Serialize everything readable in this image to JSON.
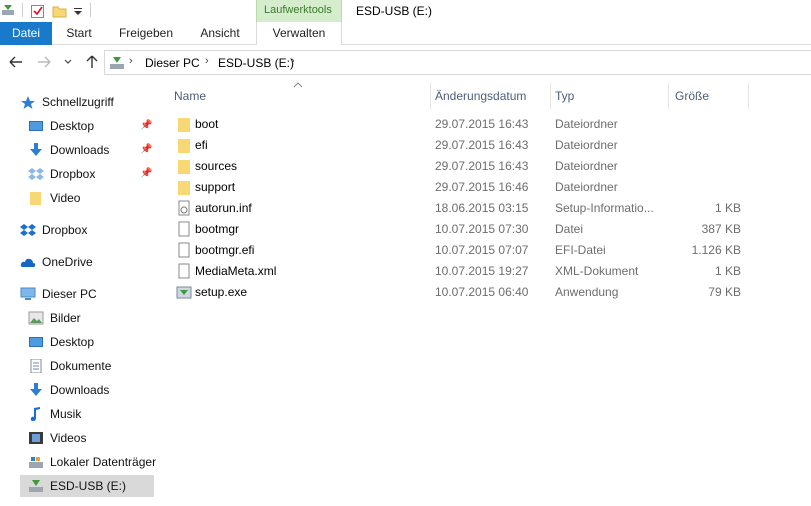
{
  "window": {
    "title": "ESD-USB (E:)",
    "context_tab_group": "Laufwerktools"
  },
  "ribbon": {
    "tabs": [
      "Datei",
      "Start",
      "Freigeben",
      "Ansicht",
      "Verwalten"
    ]
  },
  "address": {
    "crumbs": [
      "Dieser PC",
      "ESD-USB (E:)"
    ]
  },
  "nav": {
    "quick_access": "Schnellzugriff",
    "quick_items": [
      "Desktop",
      "Downloads",
      "Dropbox",
      "Video"
    ],
    "dropbox": "Dropbox",
    "onedrive": "OneDrive",
    "this_pc": "Dieser PC",
    "pc_items": [
      "Bilder",
      "Desktop",
      "Dokumente",
      "Downloads",
      "Musik",
      "Videos",
      "Lokaler Datenträger",
      "ESD-USB (E:)"
    ]
  },
  "columns": {
    "name": "Name",
    "date": "Änderungsdatum",
    "type": "Typ",
    "size": "Größe"
  },
  "files": [
    {
      "name": "boot",
      "date": "29.07.2015 16:43",
      "type": "Dateiordner",
      "size": "",
      "icon": "folder-icon"
    },
    {
      "name": "efi",
      "date": "29.07.2015 16:43",
      "type": "Dateiordner",
      "size": "",
      "icon": "folder-icon"
    },
    {
      "name": "sources",
      "date": "29.07.2015 16:43",
      "type": "Dateiordner",
      "size": "",
      "icon": "folder-icon"
    },
    {
      "name": "support",
      "date": "29.07.2015 16:46",
      "type": "Dateiordner",
      "size": "",
      "icon": "folder-icon"
    },
    {
      "name": "autorun.inf",
      "date": "18.06.2015 03:15",
      "type": "Setup-Informatio...",
      "size": "1 KB",
      "icon": "setup-info-file-icon"
    },
    {
      "name": "bootmgr",
      "date": "10.07.2015 07:30",
      "type": "Datei",
      "size": "387 KB",
      "icon": "file-icon"
    },
    {
      "name": "bootmgr.efi",
      "date": "10.07.2015 07:07",
      "type": "EFI-Datei",
      "size": "1.126 KB",
      "icon": "file-icon"
    },
    {
      "name": "MediaMeta.xml",
      "date": "10.07.2015 19:27",
      "type": "XML-Dokument",
      "size": "1 KB",
      "icon": "file-icon"
    },
    {
      "name": "setup.exe",
      "date": "10.07.2015 06:40",
      "type": "Anwendung",
      "size": "79 KB",
      "icon": "setup-exe-icon"
    }
  ],
  "colors": {
    "file_tab": "#1979ca",
    "context_tab": "#d5edcc",
    "folder": "#f8d775",
    "selected_nav": "#cce8ff"
  }
}
